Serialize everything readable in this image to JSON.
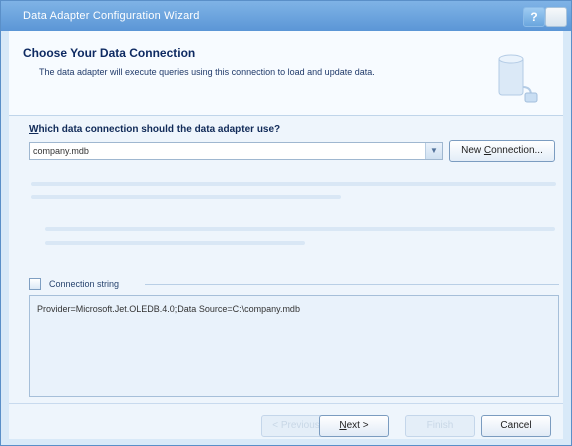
{
  "window": {
    "title": "Data Adapter Configuration Wizard",
    "help_label": "?"
  },
  "header": {
    "title": "Choose Your Data Connection",
    "subtitle": "The data adapter will execute queries using this connection to load and update data."
  },
  "connection": {
    "question_accesskey": "W",
    "question_rest": "hich data connection should the data adapter use?",
    "selected": "company.mdb",
    "new_button_pre": "New ",
    "new_button_accesskey": "C",
    "new_button_post": "onnection..."
  },
  "connection_string": {
    "label": "Connection string",
    "value": "Provider=Microsoft.Jet.OLEDB.4.0;Data Source=C:\\company.mdb"
  },
  "buttons": {
    "previous": "< Previous",
    "next_accesskey": "N",
    "next_rest": "ext >",
    "finish": "Finish",
    "cancel": "Cancel"
  },
  "colors": {
    "titlebar": "#5b96d6",
    "header_text": "#0e2a62",
    "client_bg": "#eef5fc"
  }
}
